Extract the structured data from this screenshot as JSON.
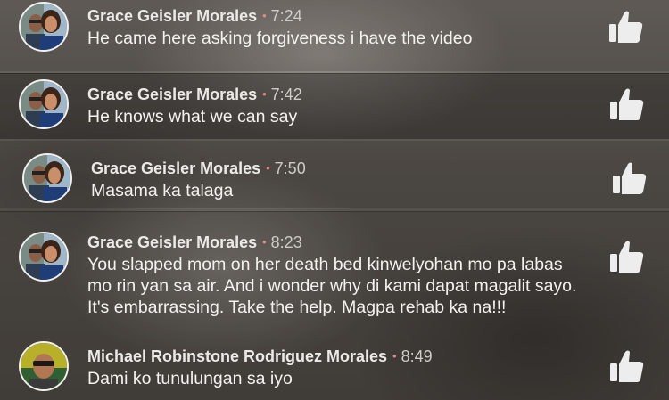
{
  "colors": {
    "accent_dot": "#e08a8a",
    "name": "#eceae7",
    "text": "#f4f2ef",
    "like": "#ededed"
  },
  "comments": [
    {
      "author": "Grace Geisler Morales",
      "time": "7:24",
      "text": "He came here asking forgiveness i have the video",
      "avatar_icon": "grace-avatar",
      "like_icon": "thumbs-up-icon",
      "highlighted": false
    },
    {
      "author": "Grace Geisler Morales",
      "time": "7:42",
      "text": "He knows what we can say",
      "avatar_icon": "grace-avatar",
      "like_icon": "thumbs-up-icon",
      "highlighted": true
    },
    {
      "author": "Grace Geisler Morales",
      "time": "7:50",
      "text": "Masama ka talaga",
      "avatar_icon": "grace-avatar",
      "like_icon": "thumbs-up-icon",
      "highlighted": false
    },
    {
      "author": "Grace Geisler Morales",
      "time": "8:23",
      "text": "You slapped mom on her death bed kinwelyohan mo pa labas mo rin yan sa air. And i wonder why di kami dapat magalit sayo. It's embarrassing. Take the help. Magpa rehab ka na!!!",
      "avatar_icon": "grace-avatar",
      "like_icon": "thumbs-up-icon",
      "highlighted": false
    },
    {
      "author": "Michael Robinstone Rodriguez Morales",
      "time": "8:49",
      "text": "Dami ko tunulungan sa iyo",
      "avatar_icon": "michael-avatar",
      "like_icon": "thumbs-up-icon",
      "highlighted": false
    }
  ]
}
